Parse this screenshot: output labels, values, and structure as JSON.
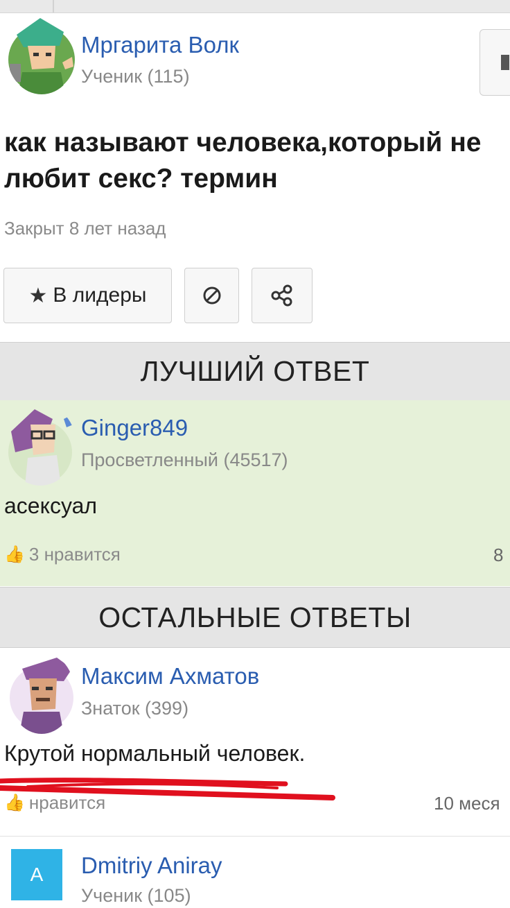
{
  "question": {
    "author": {
      "name": "Мргарита Волк",
      "rank": "Ученик (115)"
    },
    "title": "как называют человека,который не любит секс? термин",
    "closed": "Закрыт 8 лет назад",
    "actions": {
      "leaders_label": "В лидеры"
    }
  },
  "best_answer": {
    "header": "ЛУЧШИЙ ОТВЕТ",
    "author": {
      "name": "Ginger849",
      "rank": "Просветленный (45517)"
    },
    "text": "асексуал",
    "likes": "3 нравится",
    "meta": "8"
  },
  "other_answers": {
    "header": "ОСТАЛЬНЫЕ ОТВЕТЫ",
    "items": [
      {
        "author": {
          "name": "Максим Ахматов",
          "rank": "Знаток (399)"
        },
        "text": "Крутой нормальный человек.",
        "likes": "нравится",
        "meta": "10 меся"
      },
      {
        "author": {
          "name": "Dmitriy Aniray",
          "rank": "Ученик (105)",
          "initial": "A"
        }
      }
    ]
  },
  "colors": {
    "link": "#2a5db0",
    "best_bg": "#e6f1d9",
    "section_bg": "#e5e5e5",
    "scribble": "#e0101e",
    "avatar_blue": "#2fb3e6"
  },
  "icons": [
    "thumbs-up-icon",
    "star-icon",
    "block-icon",
    "share-icon"
  ]
}
